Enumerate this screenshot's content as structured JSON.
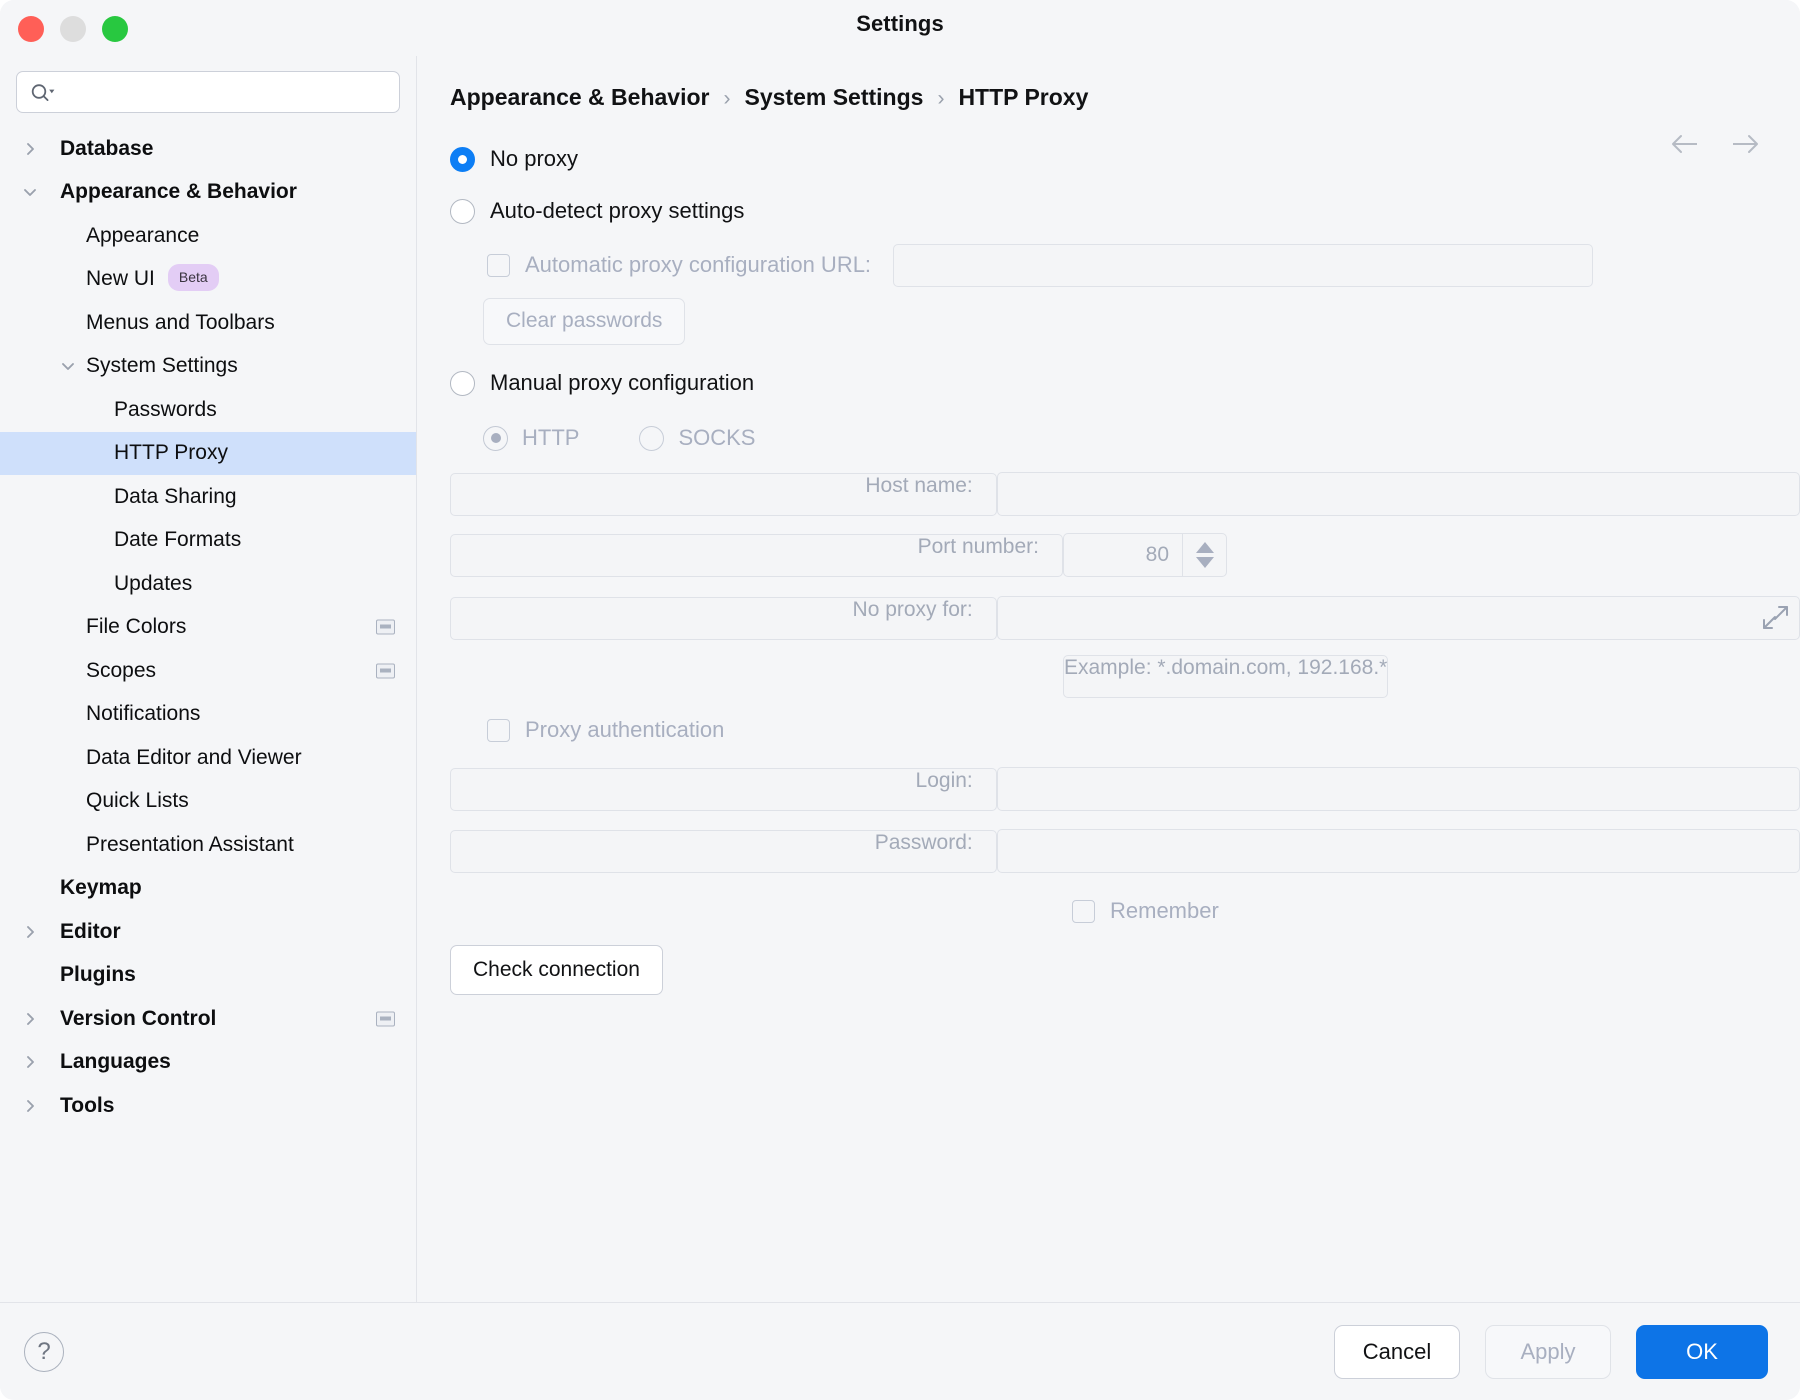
{
  "window": {
    "title": "Settings",
    "traffic_lights": [
      "close-red",
      "minimize-gray",
      "zoom-green"
    ]
  },
  "sidebar": {
    "search": {
      "value": "",
      "placeholder": ""
    },
    "items": [
      {
        "label": "Database",
        "level": 0,
        "bold": true,
        "twisty": "right"
      },
      {
        "label": "Appearance & Behavior",
        "level": 0,
        "bold": true,
        "twisty": "down"
      },
      {
        "label": "Appearance",
        "level": 1,
        "bold": false,
        "twisty": ""
      },
      {
        "label": "New UI",
        "level": 1,
        "bold": false,
        "twisty": "",
        "badge": "Beta"
      },
      {
        "label": "Menus and Toolbars",
        "level": 1,
        "bold": false,
        "twisty": ""
      },
      {
        "label": "System Settings",
        "level": 1,
        "bold": false,
        "twisty": "down"
      },
      {
        "label": "Passwords",
        "level": 2,
        "bold": false,
        "twisty": ""
      },
      {
        "label": "HTTP Proxy",
        "level": 2,
        "bold": false,
        "twisty": "",
        "selected": true
      },
      {
        "label": "Data Sharing",
        "level": 2,
        "bold": false,
        "twisty": ""
      },
      {
        "label": "Date Formats",
        "level": 2,
        "bold": false,
        "twisty": ""
      },
      {
        "label": "Updates",
        "level": 2,
        "bold": false,
        "twisty": ""
      },
      {
        "label": "File Colors",
        "level": 1,
        "bold": false,
        "twisty": "",
        "scope_icon": true
      },
      {
        "label": "Scopes",
        "level": 1,
        "bold": false,
        "twisty": "",
        "scope_icon": true
      },
      {
        "label": "Notifications",
        "level": 1,
        "bold": false,
        "twisty": ""
      },
      {
        "label": "Data Editor and Viewer",
        "level": 1,
        "bold": false,
        "twisty": ""
      },
      {
        "label": "Quick Lists",
        "level": 1,
        "bold": false,
        "twisty": ""
      },
      {
        "label": "Presentation Assistant",
        "level": 1,
        "bold": false,
        "twisty": ""
      },
      {
        "label": "Keymap",
        "level": 0,
        "bold": true,
        "twisty": ""
      },
      {
        "label": "Editor",
        "level": 0,
        "bold": true,
        "twisty": "right"
      },
      {
        "label": "Plugins",
        "level": 0,
        "bold": true,
        "twisty": ""
      },
      {
        "label": "Version Control",
        "level": 0,
        "bold": true,
        "twisty": "right",
        "scope_icon": true
      },
      {
        "label": "Languages",
        "level": 0,
        "bold": true,
        "twisty": "right"
      },
      {
        "label": "Tools",
        "level": 0,
        "bold": true,
        "twisty": "right"
      }
    ]
  },
  "breadcrumb": {
    "parts": [
      "Appearance & Behavior",
      "System Settings",
      "HTTP Proxy"
    ],
    "separator": "›"
  },
  "nav": {
    "back_icon": "arrow-left-icon",
    "forward_icon": "arrow-right-icon"
  },
  "proxy": {
    "no_proxy_label": "No proxy",
    "no_proxy_selected": true,
    "auto_detect_label": "Auto-detect proxy settings",
    "auto_detect_selected": false,
    "auto_url_checkbox_label": "Automatic proxy configuration URL:",
    "auto_url_value": "",
    "clear_passwords_label": "Clear passwords",
    "manual_label": "Manual proxy configuration",
    "manual_selected": false,
    "http_label": "HTTP",
    "http_selected": true,
    "socks_label": "SOCKS",
    "socks_selected": false,
    "host_name_label": "Host name:",
    "host_name_value": "",
    "port_number_label": "Port number:",
    "port_number_value": "80",
    "no_proxy_for_label": "No proxy for:",
    "no_proxy_for_value": "",
    "example_text": "Example: *.domain.com, 192.168.*",
    "proxy_auth_label": "Proxy authentication",
    "login_label": "Login:",
    "login_value": "",
    "password_label": "Password:",
    "password_value": "",
    "remember_label": "Remember",
    "check_connection_label": "Check connection"
  },
  "footer": {
    "help_label": "?",
    "cancel_label": "Cancel",
    "apply_label": "Apply",
    "ok_label": "OK"
  },
  "colors": {
    "accent_blue": "#0d74e7",
    "radio_blue": "#0d7ef5",
    "selection": "#cfe0fb",
    "badge_purple": "#e3cdf5",
    "disabled_text": "#a8afc0",
    "window_bg": "#f5f6f8"
  }
}
